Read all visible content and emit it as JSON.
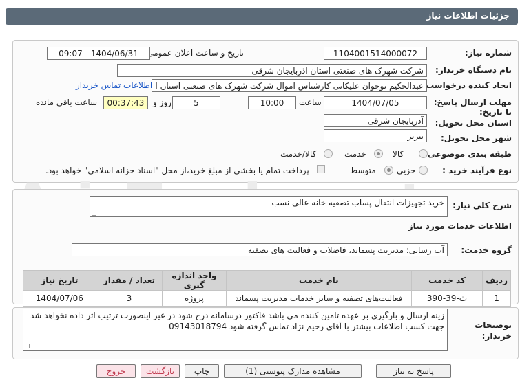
{
  "window": {
    "title": "جزئیات اطلاعات نیاز"
  },
  "watermark": "AriaTender.net",
  "labels": {
    "need_number": "شماره نیاز:",
    "announce_datetime": "تاریخ و ساعت اعلان عمومی:",
    "buyer_org": "نام دستگاه خریدار:",
    "request_creator": "ایجاد کننده درخواست:",
    "reply_deadline": "مهلت ارسال پاسخ: تا تاریخ:",
    "time_word": "ساعت",
    "days_word": "روز و",
    "remaining_word": "ساعت باقی مانده",
    "delivery_province": "استان محل تحویل:",
    "delivery_city": "شهر محل تحویل:",
    "category": "طبقه بندی موضوعی:",
    "purchase_type": "نوع فرآیند خرید :",
    "general_desc": "شرح کلی نیاز:",
    "services_header": "اطلاعات خدمات مورد نیاز",
    "service_group": "گروه خدمت:",
    "buyer_notes": "توضیحات خریدار:"
  },
  "fields": {
    "need_number": "1104001514000072",
    "announce_datetime": "1404/06/31 - 09:07",
    "buyer_org": "شرکت شهرک های صنعتی استان اذربایجان شرقی",
    "request_creator": "عبدالحکیم نوجوان علیکانی کارشناس اموال شرکت شهرک های صنعتی استان ا",
    "contact_link": "اطلاعات تماس خریدار",
    "reply_date": "1404/07/05",
    "reply_time": "10:00",
    "days": "5",
    "remaining_time": "00:37:43",
    "delivery_province": "آذربایجان شرقی",
    "delivery_city": "تبریز",
    "general_desc": "خرید تجهیزات انتقال پساب تصفیه خانه عالی نسب",
    "service_group": "آب رسانی؛ مدیریت پسماند، فاضلاب و فعالیت های تصفیه",
    "buyer_notes_line1": "زینه ارسال و بارگیری بر عهده تامین کننده می باشد فاکتور درسامانه درج شود در غیر اینصورت ترتیب اثر داده نخواهد شد",
    "buyer_notes_line2": "جهت کسب اطلاعات بیشتر با آقای رحیم نژاد تماس گرفته شود 09143018794"
  },
  "category_options": [
    {
      "label": "کالا",
      "selected": false
    },
    {
      "label": "خدمت",
      "selected": true
    },
    {
      "label": "کالا/خدمت",
      "selected": false
    }
  ],
  "purchase_options": [
    {
      "label": "جزیی",
      "selected": false
    },
    {
      "label": "متوسط",
      "selected": true
    }
  ],
  "payment_note": "پرداخت تمام یا بخشی از مبلغ خرید،از محل \"اسناد خزانه اسلامی\" خواهد بود.",
  "table": {
    "headers": [
      "ردیف",
      "کد خدمت",
      "نام خدمت",
      "واحد اندازه گیری",
      "تعداد / مقدار",
      "تاریخ نیاز"
    ],
    "rows": [
      [
        "1",
        "ث-39-390",
        "فعالیت‌های تصفیه و سایر خدمات مدیریت پسماند",
        "پروژه",
        "3",
        "1404/07/06"
      ]
    ]
  },
  "buttons": {
    "reply": "پاسخ به نیاز",
    "view_docs": "مشاهده مدارک پیوستی (1)",
    "print": "چاپ",
    "back": "بازگشت",
    "exit": "خروج"
  }
}
